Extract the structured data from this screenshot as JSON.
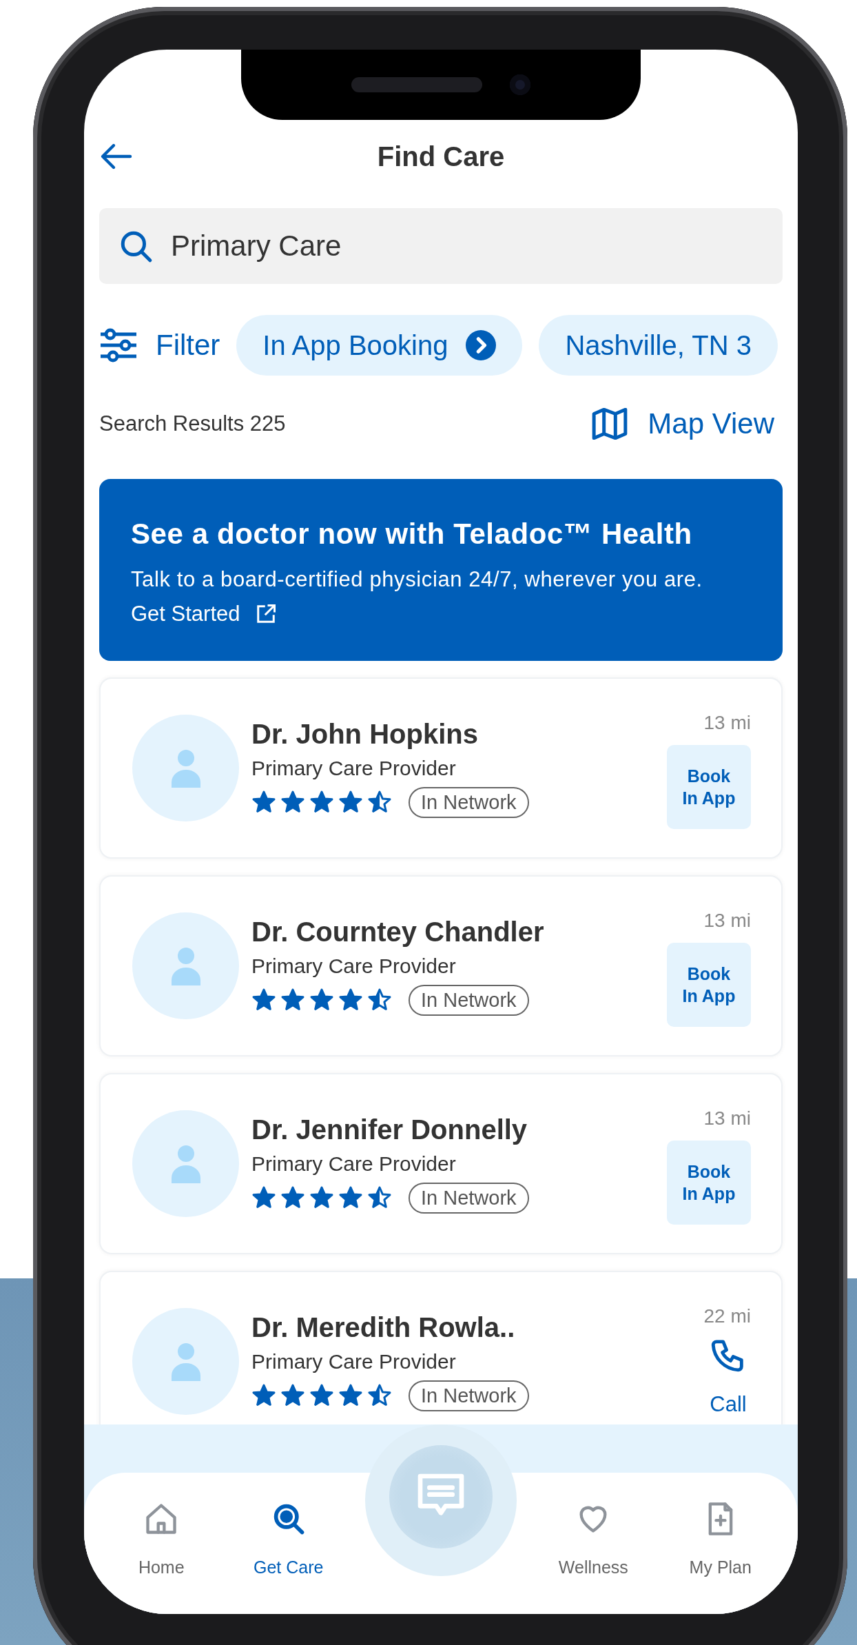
{
  "header": {
    "title": "Find Care"
  },
  "search": {
    "value": "Primary Care"
  },
  "filters": {
    "filter_label": "Filter",
    "chips": [
      {
        "label": "In App Booking",
        "kind": "arrow"
      },
      {
        "label": "Nashville, TN 3",
        "kind": "plain"
      }
    ]
  },
  "results": {
    "count_label": "Search Results 225",
    "map_view": "Map View"
  },
  "banner": {
    "title": "See a doctor now with Teladoc™ Health",
    "body": "Talk to a board-certified physician 24/7, wherever you are.",
    "link": "Get Started"
  },
  "providers": [
    {
      "name": "Dr. John Hopkins",
      "specialty": "Primary Care Provider",
      "stars": 4.5,
      "network": "In Network",
      "distance": "13 mi",
      "action": {
        "kind": "book",
        "label": "Book\nIn App"
      }
    },
    {
      "name": "Dr. Courntey Chandler",
      "specialty": "Primary Care Provider",
      "stars": 4.5,
      "network": "In Network",
      "distance": "13 mi",
      "action": {
        "kind": "book",
        "label": "Book\nIn App"
      }
    },
    {
      "name": "Dr. Jennifer Donnelly",
      "specialty": "Primary Care Provider",
      "stars": 4.5,
      "network": "In Network",
      "distance": "13 mi",
      "action": {
        "kind": "book",
        "label": "Book\nIn App"
      }
    },
    {
      "name": "Dr. Meredith Rowla..",
      "specialty": "Primary Care Provider",
      "stars": 4.5,
      "network": "In Network",
      "distance": "22 mi",
      "action": {
        "kind": "call",
        "label": "Call"
      }
    }
  ],
  "nav": [
    {
      "label": "Home",
      "kind": "home",
      "selected": false
    },
    {
      "label": "Get Care",
      "kind": "search",
      "selected": true
    },
    {
      "label": "Wellness",
      "kind": "heart",
      "selected": false
    },
    {
      "label": "My Plan",
      "kind": "plan",
      "selected": false
    }
  ]
}
